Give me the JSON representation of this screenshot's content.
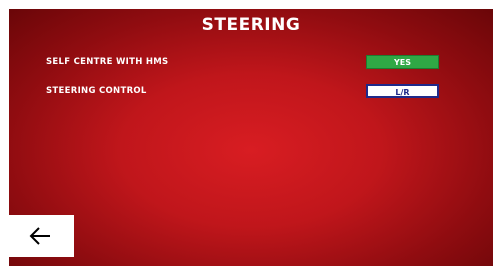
{
  "screen": {
    "title": "STEERING"
  },
  "settings": [
    {
      "label": "SELF CENTRE WITH HMS",
      "value": "YES",
      "value_color": "#2fa845"
    },
    {
      "label": "STEERING CONTROL",
      "value": "L/R",
      "value_color": "#ffffff"
    }
  ],
  "navigation": {
    "back_icon": "left-arrow-icon"
  }
}
